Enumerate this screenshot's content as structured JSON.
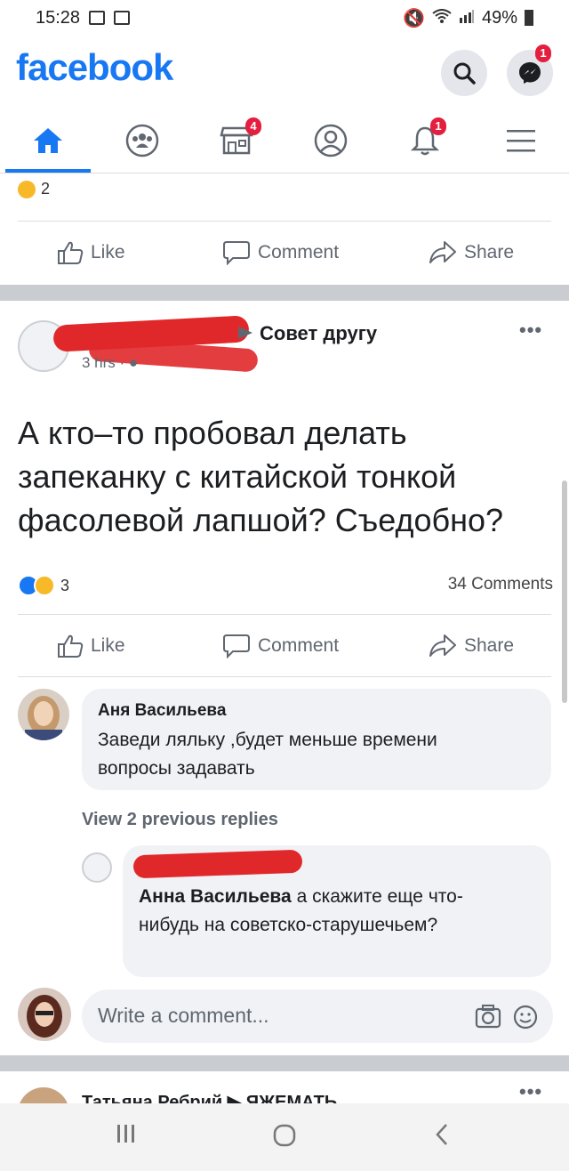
{
  "status_bar": {
    "time": "15:28",
    "battery": "49%"
  },
  "header": {
    "logo": "facebook",
    "messenger_badge": "1"
  },
  "nav": {
    "marketplace_badge": "4",
    "notifications_badge": "1"
  },
  "prev_post": {
    "reaction_count": "2",
    "actions": {
      "like": "Like",
      "comment": "Comment",
      "share": "Share"
    }
  },
  "post": {
    "group": "Совет другу",
    "time": "3 hrs",
    "text": "А кто–то пробовал делать запеканку с китайской тонкой фасолевой лапшой? Съедобно?",
    "reaction_count": "3",
    "comments_count": "34 Comments",
    "actions": {
      "like": "Like",
      "comment": "Comment",
      "share": "Share"
    }
  },
  "comments": [
    {
      "author": "Аня Васильева",
      "text": "Заведи ляльку ,будет меньше времени вопросы задавать"
    }
  ],
  "view_previous": "View 2 previous replies",
  "reply": {
    "mention": "Анна Васильева",
    "text": " а скажите еще что-нибудь на советско-старушечьем?"
  },
  "write_comment": {
    "placeholder": "Write a comment..."
  },
  "next_post": {
    "header": "Татьяна Ребрий ▶ ЯЖЕМАТЬ"
  },
  "colors": {
    "brand": "#1877f2",
    "badge": "#e41e3f",
    "redaction": "#e0282a"
  }
}
